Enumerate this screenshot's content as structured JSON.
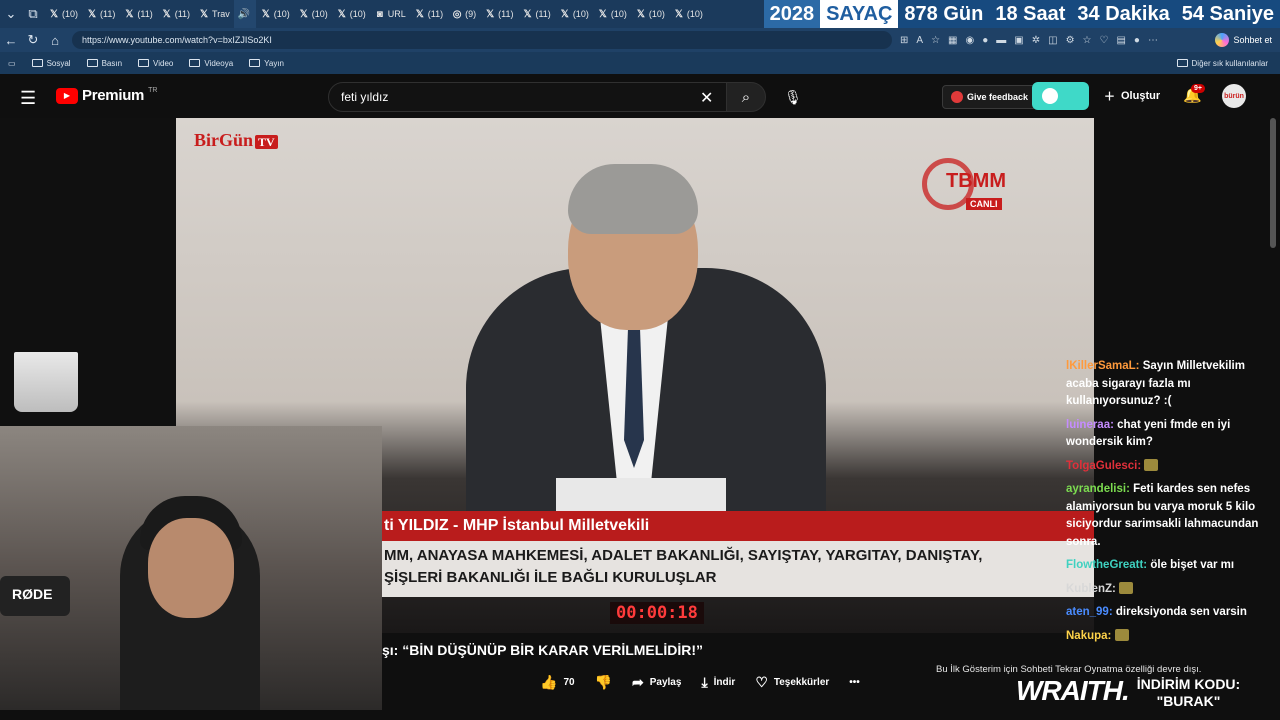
{
  "browser": {
    "tabs": [
      {
        "icon": "x",
        "label": "(10)"
      },
      {
        "icon": "x",
        "label": "(11)"
      },
      {
        "icon": "x",
        "label": "(11)"
      },
      {
        "icon": "x",
        "label": "(11)"
      },
      {
        "icon": "x",
        "label": "Trav"
      },
      {
        "icon": "speaker",
        "label": ""
      },
      {
        "icon": "x",
        "label": "(10)"
      },
      {
        "icon": "x",
        "label": "(10)"
      },
      {
        "icon": "x",
        "label": "(10)"
      },
      {
        "icon": "url",
        "label": "URL"
      },
      {
        "icon": "x",
        "label": "(11)"
      },
      {
        "icon": "insta",
        "label": "(9)"
      },
      {
        "icon": "x",
        "label": "(11)"
      },
      {
        "icon": "x",
        "label": "(11)"
      },
      {
        "icon": "x",
        "label": "(10)"
      },
      {
        "icon": "x",
        "label": "(10)"
      },
      {
        "icon": "x",
        "label": "(10)"
      },
      {
        "icon": "x",
        "label": "(10)"
      }
    ],
    "counter": {
      "year": "2028",
      "label": "SAYAÇ",
      "days": "878 Gün",
      "hours": "18 Saat",
      "minutes": "34 Dakika",
      "seconds": "54 Saniye"
    },
    "url": "https://www.youtube.com/watch?v=bxIZJISo2KI",
    "chat_button": "Sohbet et",
    "bookmarks": [
      "Sosyal",
      "Basın",
      "Video",
      "Videoya",
      "Yayın"
    ],
    "bookmarks_other": "Diğer sık kullanılanlar"
  },
  "youtube": {
    "logo": "Premium",
    "logo_country": "TR",
    "search_value": "feti yıldız",
    "feedback": "Give feedback",
    "create": "Oluştur",
    "notif_badge": "9+",
    "avatar_text": "bürün"
  },
  "video": {
    "channel_logo": "BirGün",
    "channel_logo_tv": "TV",
    "tbmm": "TBMM",
    "tbmm_live": "CANLI",
    "ticker_name": "ti YILDIZ - MHP İstanbul Milletvekili",
    "ticker_line1": "MM, ANAYASA MAHKEMESİ, ADALET BAKANLIĞI, SAYIŞTAY, YARGITAY, DANIŞTAY,",
    "ticker_line2": "ŞİŞLERİ BAKANLIĞI İLE BAĞLI KURULUŞLAR",
    "clock": "00:00:18",
    "mic_brand": "RØDE"
  },
  "chat": [
    {
      "user": "lKillerSamaL:",
      "color": "#ff9a3c",
      "text": "Sayın Milletvekilim acaba sigarayı fazla mı kullanıyorsunuz? :("
    },
    {
      "user": "luineraa:",
      "color": "#c58cff",
      "text": "chat yeni fmde en iyi wondersik kim?"
    },
    {
      "user": "TolgaGulesci:",
      "color": "#e0303a",
      "text": ""
    },
    {
      "user": "ayrandelisi:",
      "color": "#7cdc50",
      "text": "Feti kardes sen nefes alamiyorsun bu varya moruk 5 kilo siciyordur sarimsakli lahmacundan sonra."
    },
    {
      "user": "FlowtheGreatt:",
      "color": "#3fd1c0",
      "text": "öle bişet var mı"
    },
    {
      "user": "KublenZ:",
      "color": "#d8d8d8",
      "text": ""
    },
    {
      "user": "aten_99:",
      "color": "#4a8cff",
      "text": "direksiyonda sen varsin"
    },
    {
      "user": "Nakupa:",
      "color": "#ffd34a",
      "text": ""
    }
  ],
  "below": {
    "title_fragment": "şı: “BİN DÜŞÜNÜP BİR KARAR VERİLMELİDİR!”",
    "likes": "70",
    "share": "Paylaş",
    "download": "İndir",
    "thanks": "Teşekkürler",
    "more": "•••",
    "replay_note": "Bu İlk Gösterim için Sohbeti Tekrar Oynatma özelliği devre dışı.",
    "promo_brand": "WRAITH.",
    "promo_code_label": "İNDİRİM KODU:",
    "promo_code": "\"BURAK\""
  }
}
